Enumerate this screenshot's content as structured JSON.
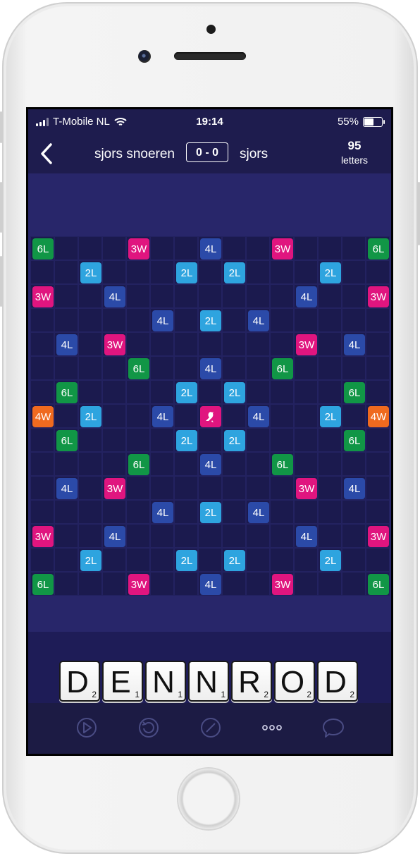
{
  "status_bar": {
    "carrier": "T-Mobile NL",
    "time": "19:14",
    "battery": "55%",
    "battery_level": 0.55
  },
  "header": {
    "player_left": "sjors snoeren",
    "score": "0 - 0",
    "player_right": "sjors",
    "letters_count": "95",
    "letters_label": "letters"
  },
  "board": {
    "size": 15,
    "premium_squares": [
      {
        "r": 0,
        "c": 0,
        "label": "6L"
      },
      {
        "r": 0,
        "c": 4,
        "label": "3W"
      },
      {
        "r": 0,
        "c": 7,
        "label": "4L"
      },
      {
        "r": 0,
        "c": 10,
        "label": "3W"
      },
      {
        "r": 0,
        "c": 14,
        "label": "6L"
      },
      {
        "r": 1,
        "c": 2,
        "label": "2L"
      },
      {
        "r": 1,
        "c": 6,
        "label": "2L"
      },
      {
        "r": 1,
        "c": 8,
        "label": "2L"
      },
      {
        "r": 1,
        "c": 12,
        "label": "2L"
      },
      {
        "r": 2,
        "c": 0,
        "label": "3W"
      },
      {
        "r": 2,
        "c": 3,
        "label": "4L"
      },
      {
        "r": 2,
        "c": 11,
        "label": "4L"
      },
      {
        "r": 2,
        "c": 14,
        "label": "3W"
      },
      {
        "r": 3,
        "c": 5,
        "label": "4L"
      },
      {
        "r": 3,
        "c": 7,
        "label": "2L"
      },
      {
        "r": 3,
        "c": 9,
        "label": "4L"
      },
      {
        "r": 4,
        "c": 1,
        "label": "4L"
      },
      {
        "r": 4,
        "c": 3,
        "label": "3W"
      },
      {
        "r": 4,
        "c": 11,
        "label": "3W"
      },
      {
        "r": 4,
        "c": 13,
        "label": "4L"
      },
      {
        "r": 5,
        "c": 4,
        "label": "6L"
      },
      {
        "r": 5,
        "c": 7,
        "label": "4L"
      },
      {
        "r": 5,
        "c": 10,
        "label": "6L"
      },
      {
        "r": 6,
        "c": 1,
        "label": "6L"
      },
      {
        "r": 6,
        "c": 6,
        "label": "2L"
      },
      {
        "r": 6,
        "c": 8,
        "label": "2L"
      },
      {
        "r": 6,
        "c": 13,
        "label": "6L"
      },
      {
        "r": 7,
        "c": 0,
        "label": "4W"
      },
      {
        "r": 7,
        "c": 2,
        "label": "2L"
      },
      {
        "r": 7,
        "c": 5,
        "label": "4L"
      },
      {
        "r": 7,
        "c": 7,
        "label": "center"
      },
      {
        "r": 7,
        "c": 9,
        "label": "4L"
      },
      {
        "r": 7,
        "c": 12,
        "label": "2L"
      },
      {
        "r": 7,
        "c": 14,
        "label": "4W"
      },
      {
        "r": 8,
        "c": 1,
        "label": "6L"
      },
      {
        "r": 8,
        "c": 6,
        "label": "2L"
      },
      {
        "r": 8,
        "c": 8,
        "label": "2L"
      },
      {
        "r": 8,
        "c": 13,
        "label": "6L"
      },
      {
        "r": 9,
        "c": 4,
        "label": "6L"
      },
      {
        "r": 9,
        "c": 7,
        "label": "4L"
      },
      {
        "r": 9,
        "c": 10,
        "label": "6L"
      },
      {
        "r": 10,
        "c": 1,
        "label": "4L"
      },
      {
        "r": 10,
        "c": 3,
        "label": "3W"
      },
      {
        "r": 10,
        "c": 11,
        "label": "3W"
      },
      {
        "r": 10,
        "c": 13,
        "label": "4L"
      },
      {
        "r": 11,
        "c": 5,
        "label": "4L"
      },
      {
        "r": 11,
        "c": 7,
        "label": "2L"
      },
      {
        "r": 11,
        "c": 9,
        "label": "4L"
      },
      {
        "r": 12,
        "c": 0,
        "label": "3W"
      },
      {
        "r": 12,
        "c": 3,
        "label": "4L"
      },
      {
        "r": 12,
        "c": 11,
        "label": "4L"
      },
      {
        "r": 12,
        "c": 14,
        "label": "3W"
      },
      {
        "r": 13,
        "c": 2,
        "label": "2L"
      },
      {
        "r": 13,
        "c": 6,
        "label": "2L"
      },
      {
        "r": 13,
        "c": 8,
        "label": "2L"
      },
      {
        "r": 13,
        "c": 12,
        "label": "2L"
      },
      {
        "r": 14,
        "c": 0,
        "label": "6L"
      },
      {
        "r": 14,
        "c": 4,
        "label": "3W"
      },
      {
        "r": 14,
        "c": 7,
        "label": "4L"
      },
      {
        "r": 14,
        "c": 10,
        "label": "3W"
      },
      {
        "r": 14,
        "c": 14,
        "label": "6L"
      }
    ],
    "center_icon": "bird-icon",
    "colors": {
      "2L": "#2ea4df",
      "4L": "#2b4aa8",
      "3W": "#e0157f",
      "6L": "#119646",
      "4W": "#ef6a1f"
    }
  },
  "rack": [
    {
      "letter": "D",
      "value": "2"
    },
    {
      "letter": "E",
      "value": "1"
    },
    {
      "letter": "N",
      "value": "1"
    },
    {
      "letter": "N",
      "value": "1"
    },
    {
      "letter": "R",
      "value": "2"
    },
    {
      "letter": "O",
      "value": "2"
    },
    {
      "letter": "D",
      "value": "2"
    }
  ],
  "toolbar": [
    "play-icon",
    "shuffle-icon",
    "pass-icon",
    "more-icon",
    "chat-icon"
  ]
}
